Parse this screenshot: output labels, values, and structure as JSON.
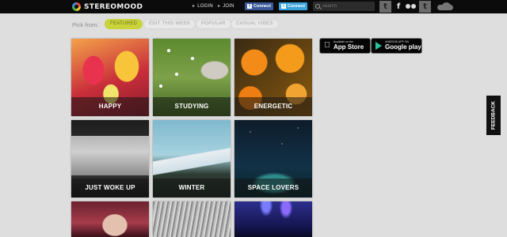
{
  "header": {
    "logo_text": "STEREOMOOD",
    "login_label": "LOGIN",
    "join_label": "JOIN",
    "facebook_connect_label": "Connect",
    "twitter_connect_label": "Connect",
    "search_placeholder": "search",
    "social": [
      "twitter-icon",
      "facebook-icon",
      "flickr-icon",
      "tumblr-icon",
      "soundcloud-icon"
    ]
  },
  "filters": {
    "label": "Pick from:",
    "options": [
      "FEATURED",
      "EDIT THIS WEEK",
      "POPULAR",
      "CASUAL VIBES"
    ],
    "selected": "FEATURED"
  },
  "moods": [
    {
      "label": "HAPPY"
    },
    {
      "label": "STUDYING"
    },
    {
      "label": "ENERGETIC"
    },
    {
      "label": "JUST WOKE UP"
    },
    {
      "label": "WINTER"
    },
    {
      "label": "SPACE LOVERS"
    }
  ],
  "stores": {
    "appstore_small": "Available on the",
    "appstore_big": "App Store",
    "gplay_small": "ANDROID APP ON",
    "gplay_big": "Google play"
  },
  "feedback_label": "FEEDBACK",
  "colors": {
    "accent": "#c9d33a",
    "topbar": "#0b0b0b",
    "background": "#dedede",
    "facebook": "#3b5998",
    "twitter": "#3aa4dd"
  }
}
